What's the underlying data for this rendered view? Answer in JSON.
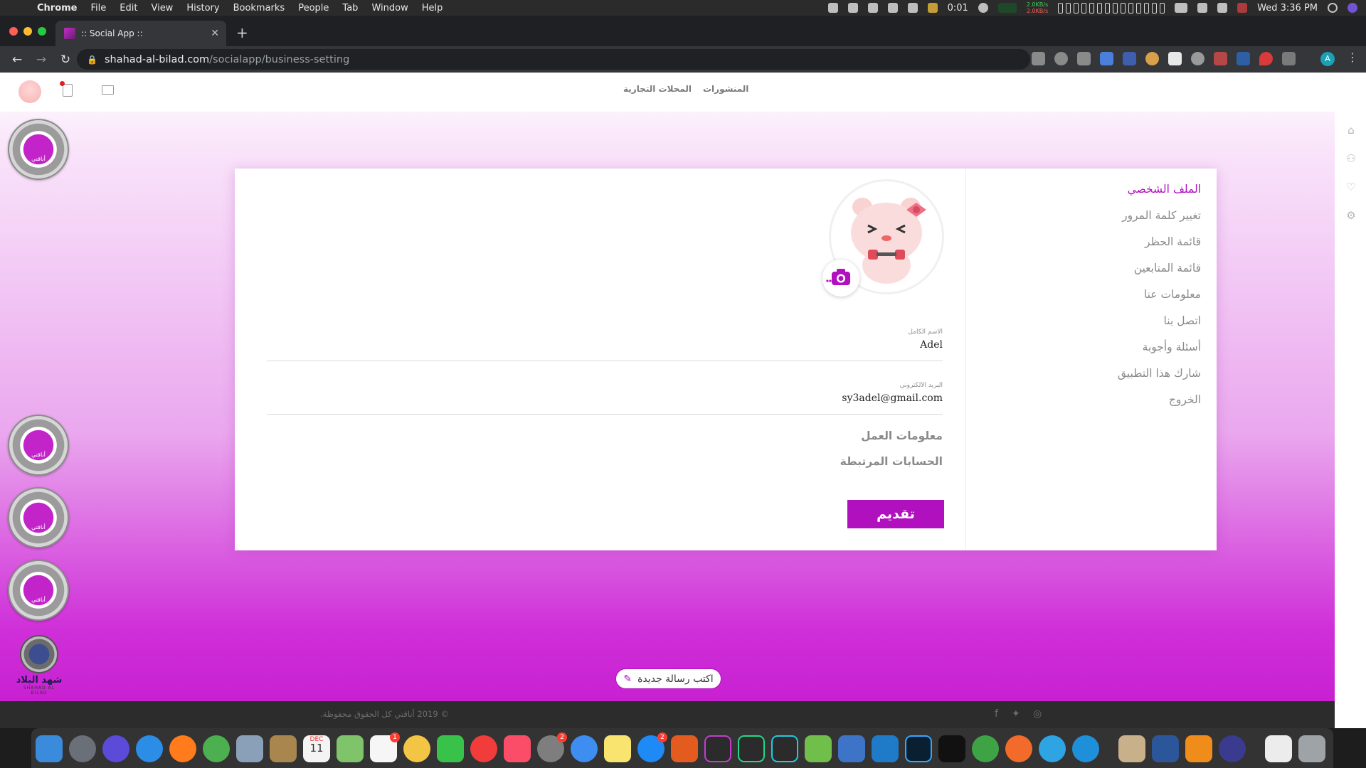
{
  "menubar": {
    "app_name": "Chrome",
    "items": [
      "File",
      "Edit",
      "View",
      "History",
      "Bookmarks",
      "People",
      "Tab",
      "Window",
      "Help"
    ],
    "timer": "0:01",
    "net_tx": "2.0KB/s",
    "net_rx": "2.0KB/s",
    "clock": "Wed 3:36 PM"
  },
  "browser": {
    "tab_title": ":: Social App ::",
    "url_host": "shahad-al-bilad.com",
    "url_path": "/socialapp/business-setting",
    "profile_initial": "A"
  },
  "header": {
    "link_posts": "المنشورات",
    "link_shops": "المحلات التجارية"
  },
  "settings_menu": [
    {
      "label": "الملف الشخصي",
      "active": true
    },
    {
      "label": "تغيير كلمة المرور",
      "active": false
    },
    {
      "label": "قائمة الحظر",
      "active": false
    },
    {
      "label": "قائمة المتابعين",
      "active": false
    },
    {
      "label": "معلومات عنا",
      "active": false
    },
    {
      "label": "اتصل بنا",
      "active": false
    },
    {
      "label": "أسئلة وأجوبة",
      "active": false
    },
    {
      "label": "شارك هذا التطبيق",
      "active": false
    },
    {
      "label": "الخروج",
      "active": false
    }
  ],
  "profile": {
    "full_name_label": "الاسم الكامل",
    "full_name": "Adel",
    "email_label": "البريد الالكتروني",
    "email": "sy3adel@gmail.com",
    "work_info": "معلومات العمل",
    "linked_accounts": "الحسابات المرتبطة",
    "submit": "تقديم"
  },
  "compose": {
    "label": "اكتب رسالة جديدة"
  },
  "side_logos": {
    "brand_text": "أناقتي",
    "site_name": "شهد البلاد",
    "site_tag": "SHAHAD AL BILAD"
  },
  "footer": {
    "copyright": "© 2019 أناقتي كل الحقوق محفوظة."
  },
  "dock": {
    "badges": {
      "reminders": "1",
      "system_prefs": "2",
      "app_store": "2"
    },
    "calendar_month": "DEC",
    "calendar_day": "11"
  },
  "colors": {
    "accent": "#b010be",
    "gradient_end": "#c61bd0",
    "footer": "#2c2c2c"
  }
}
